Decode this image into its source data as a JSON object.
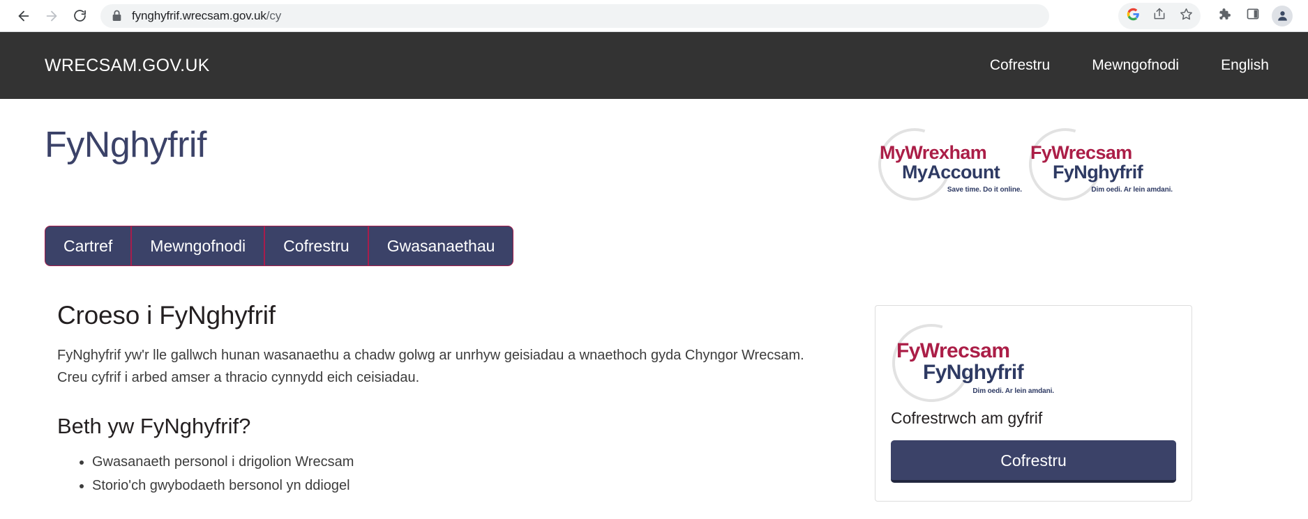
{
  "browser": {
    "back_icon": "back-arrow-icon",
    "forward_icon": "forward-arrow-icon",
    "reload_icon": "reload-icon",
    "lock_icon": "lock-icon",
    "url_domain": "fynghyfrif.wrecsam.gov.uk",
    "url_path": "/cy",
    "icons": {
      "google": "google-icon",
      "share": "share-icon",
      "bookmark": "bookmark-star-icon",
      "extensions": "extensions-puzzle-icon",
      "side_panel": "side-panel-icon",
      "profile": "profile-avatar-icon"
    }
  },
  "header": {
    "brand": "WRECSAM.GOV.UK",
    "nav": [
      {
        "label": "Cofrestru"
      },
      {
        "label": "Mewngofnodi"
      },
      {
        "label": "English"
      }
    ]
  },
  "page": {
    "title": "FyNghyfrif"
  },
  "logos": {
    "english": {
      "line1": "MyWrexham",
      "line2": "MyAccount",
      "tagline": "Save time. Do it online."
    },
    "welsh": {
      "line1": "FyWrecsam",
      "line2": "FyNghyfrif",
      "tagline": "Dim oedi. Ar lein amdani."
    }
  },
  "tabs": [
    {
      "label": "Cartref"
    },
    {
      "label": "Mewngofnodi"
    },
    {
      "label": "Cofrestru"
    },
    {
      "label": "Gwasanaethau"
    }
  ],
  "main": {
    "heading": "Croeso i FyNghyfrif",
    "lead": "FyNghyfrif yw'r lle gallwch hunan wasanaethu a chadw golwg ar unrhyw geisiadau a wnaethoch gyda Chyngor Wrecsam. Creu cyfrif i arbed amser a thracio cynnydd eich ceisiadau.",
    "subheading": "Beth yw FyNghyfrif?",
    "bullets": [
      "Gwasanaeth personol i drigolion Wrecsam",
      "Storio'ch gwybodaeth bersonol yn ddiogel"
    ]
  },
  "sidebar_card": {
    "logo_line1": "FyWrecsam",
    "logo_line2": "FyNghyfrif",
    "logo_tagline": "Dim oedi. Ar lein amdani.",
    "heading": "Cofrestrwch am gyfrif",
    "button_label": "Cofrestru"
  },
  "colors": {
    "navy": "#3b4268",
    "crimson": "#a81d4c",
    "header_dark": "#333333"
  }
}
